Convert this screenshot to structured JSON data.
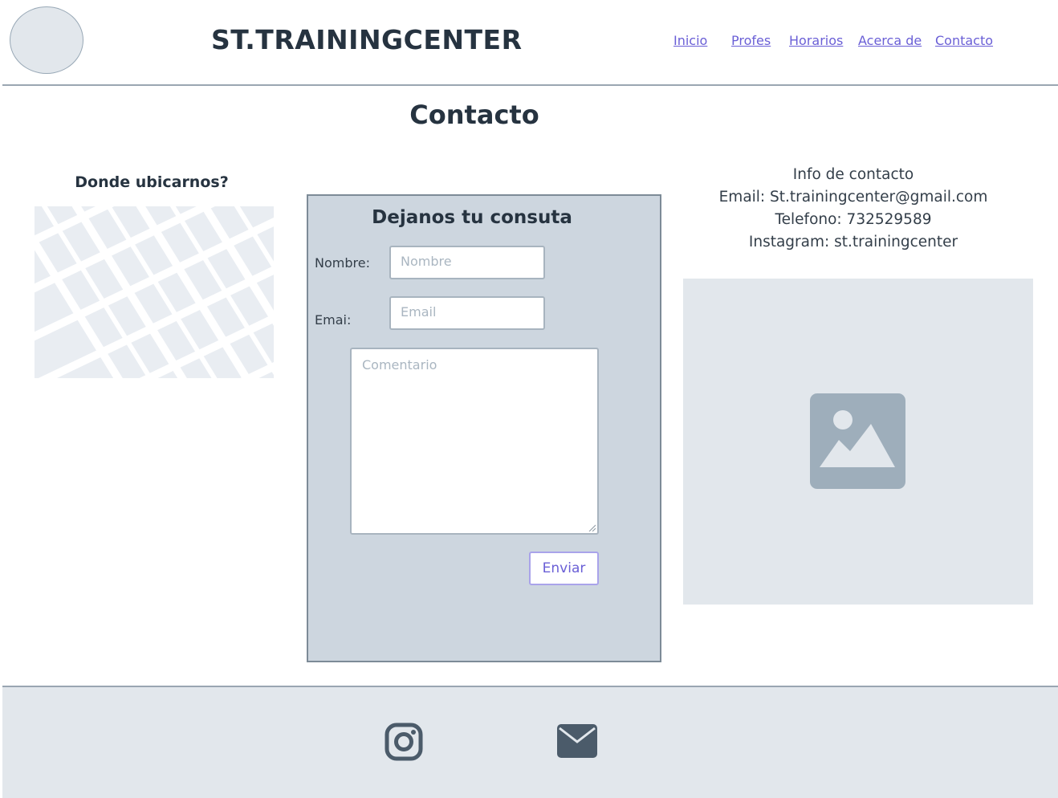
{
  "header": {
    "brand": "ST.TRAININGCENTER",
    "nav": [
      "Inicio",
      "Profes",
      "Horarios",
      "Acerca de ",
      "Contacto"
    ],
    "icons": {
      "logo": "logo-placeholder"
    }
  },
  "page": {
    "title": "Contacto"
  },
  "location": {
    "heading": "Donde ubicarnos?",
    "icon": "map-placeholder"
  },
  "form": {
    "title": "Dejanos tu consuta",
    "name_label": "Nombre:",
    "name_placeholder": "Nombre",
    "email_label": "Emai:",
    "email_placeholder": "Email",
    "comment_placeholder": "Comentario",
    "submit_label": "Enviar"
  },
  "contact_info": {
    "heading": "Info de contacto",
    "email": "Email: St.trainingcenter@gmail.com",
    "phone": "Telefono: 732529589",
    "instagram": "Instagram: st.trainingcenter",
    "image_icon": "image-placeholder-icon"
  },
  "footer": {
    "icons": [
      "instagram-icon",
      "mail-icon"
    ]
  },
  "colors": {
    "text_dark": "#263340",
    "link": "#6a5fd6",
    "form_bg": "#cdd6df",
    "placeholder_bg": "#e2e7ec",
    "icon_fill": "#9eaebb",
    "footer_icon": "#4b5b6a"
  }
}
